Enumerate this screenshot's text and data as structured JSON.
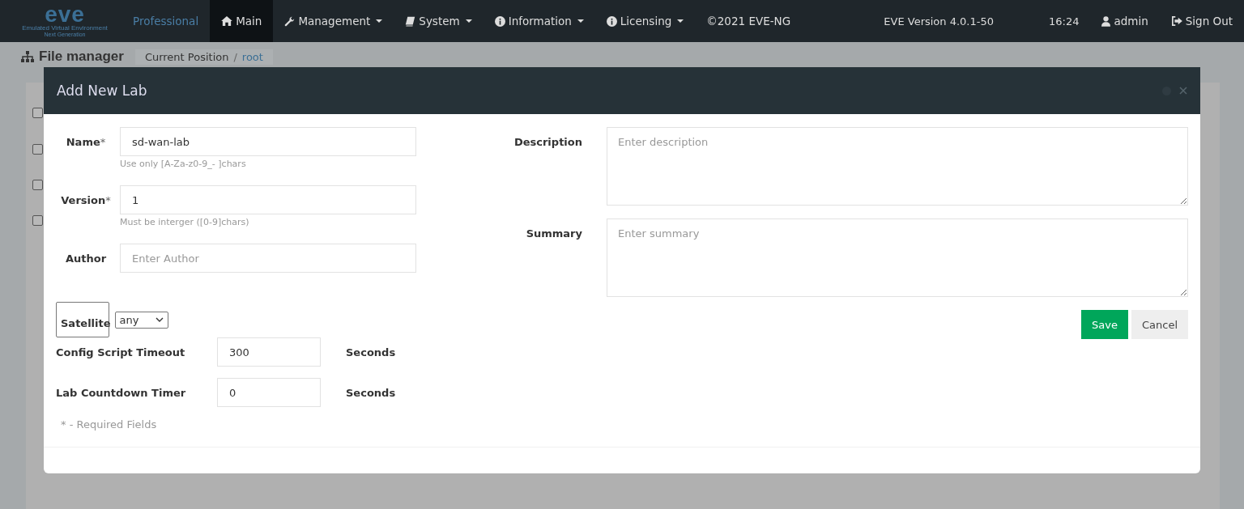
{
  "navbar": {
    "logo": {
      "text": "eve",
      "tagline": "Emulated Virtual Environment",
      "subtagline": "Next Generation"
    },
    "items": [
      {
        "label": "Professional",
        "kind": "brand",
        "selected": false,
        "dropdown": false
      },
      {
        "label": "Main",
        "kind": "home",
        "selected": true,
        "dropdown": false
      },
      {
        "label": "Management",
        "kind": "wrench",
        "selected": false,
        "dropdown": true
      },
      {
        "label": "System",
        "kind": "book",
        "selected": false,
        "dropdown": true
      },
      {
        "label": "Information",
        "kind": "info",
        "selected": false,
        "dropdown": true
      },
      {
        "label": "Licensing",
        "kind": "info",
        "selected": false,
        "dropdown": true
      },
      {
        "label": "©2021 EVE-NG",
        "kind": "text",
        "selected": false,
        "dropdown": false
      }
    ],
    "version": "EVE Version 4.0.1-50",
    "time": "16:24",
    "user": "admin",
    "sign_out": "Sign Out"
  },
  "page": {
    "title": "File manager",
    "breadcrumb": {
      "label": "Current Position",
      "separator": "/",
      "path": "root"
    },
    "rows": [
      {
        "checked": false
      },
      {
        "checked": false
      },
      {
        "checked": false
      },
      {
        "checked": false
      }
    ]
  },
  "dialog": {
    "title": "Add New Lab",
    "required_mark": "*",
    "left_fields": [
      {
        "label": "Name",
        "required": true,
        "kind": "text",
        "value": "sd-wan-lab",
        "help": "Use only [A-Za-z0-9_- ]chars"
      },
      {
        "label": "Version",
        "required": true,
        "kind": "text",
        "value": "1",
        "help": "Must be interger ([0-9]chars)"
      },
      {
        "label": "Author",
        "required": false,
        "kind": "text",
        "placeholder": "Enter Author"
      },
      {
        "label": "Satellite",
        "required": false,
        "kind": "select",
        "value": "any"
      }
    ],
    "timers": [
      {
        "label": "Config Script Timeout",
        "value": "300",
        "unit": "Seconds"
      },
      {
        "label": "Lab Countdown Timer",
        "value": "0",
        "unit": "Seconds"
      }
    ],
    "required_note": "* - Required Fields",
    "right_fields": [
      {
        "label": "Description",
        "placeholder": "Enter description"
      },
      {
        "label": "Summary",
        "placeholder": "Enter summary"
      }
    ],
    "buttons": [
      {
        "label": "Save",
        "kind": "primary"
      },
      {
        "label": "Cancel",
        "kind": "default"
      }
    ]
  }
}
